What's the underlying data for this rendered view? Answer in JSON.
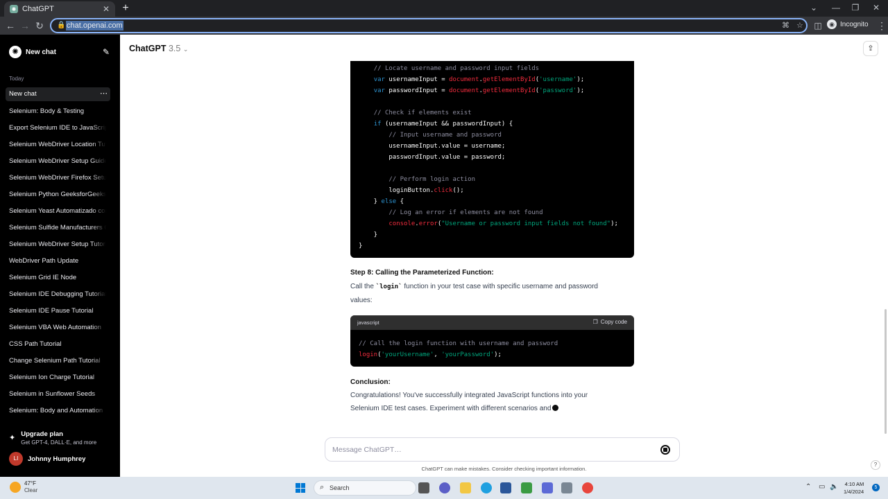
{
  "browser": {
    "tab_title": "ChatGPT",
    "tab_close": "✕",
    "new_tab": "+",
    "url": "chat.openai.com",
    "incognito_label": "Incognito",
    "window_controls": [
      "⌄",
      "—",
      "❐",
      "✕"
    ]
  },
  "sidebar": {
    "new_chat": "New chat",
    "section_today": "Today",
    "active_chat": "New chat",
    "items": [
      "Selenium: Body & Testing",
      "Export Selenium IDE to JavaScript",
      "Selenium WebDriver Location Tutorial",
      "Selenium WebDriver Setup Guide",
      "Selenium WebDriver Firefox Setup",
      "Selenium Python GeeksforGeeks",
      "Selenium Yeast Automatizado com",
      "Selenium Sulfide Manufacturers G",
      "Selenium WebDriver Setup Tutorial",
      "WebDriver Path Update",
      "Selenium Grid IE Node",
      "Selenium IDE Debugging Tutorial",
      "Selenium IDE Pause Tutorial",
      "Selenium VBA Web Automation",
      "CSS Path Tutorial",
      "Change Selenium Path Tutorial",
      "Selenium Ion Charge Tutorial",
      "Selenium in Sunflower Seeds",
      "Selenium: Body and Automation"
    ],
    "upgrade_title": "Upgrade plan",
    "upgrade_sub": "Get GPT-4, DALL·E, and more",
    "user_initials": "LI",
    "user_name": "Johnny Humphrey"
  },
  "main": {
    "model_name": "ChatGPT",
    "model_version": "3.5",
    "step_title": "Step 8: Calling the Parameterized Function:",
    "step_text_pre": "Call the ",
    "step_text_code": "`login`",
    "step_text_post": " function in your test case with specific username and password values:",
    "code2_lang": "javascript",
    "copy_label": "Copy code",
    "conclusion_title": "Conclusion:",
    "conclusion_text": "Congratulations! You've successfully integrated JavaScript functions into your Selenium IDE test cases. Experiment with different scenarios and",
    "composer_placeholder": "Message ChatGPT…",
    "disclaimer": "ChatGPT can make mistakes. Consider checking important information.",
    "help": "?"
  },
  "code1_lines": [
    "    // Locate username and password input fields",
    "    var usernameInput = document.getElementById('username');",
    "    var passwordInput = document.getElementById('password');",
    "",
    "    // Check if elements exist",
    "    if (usernameInput && passwordInput) {",
    "        // Input username and password",
    "        usernameInput.value = username;",
    "        passwordInput.value = password;",
    "",
    "        // Perform login action",
    "        loginButton.click();",
    "    } else {",
    "        // Log an error if elements are not found",
    "        console.error(\"Username or password input fields not found\");",
    "    }",
    "}"
  ],
  "code2_lines": [
    "// Call the login function with username and password",
    "login('yourUsername', 'yourPassword');"
  ],
  "taskbar": {
    "temp": "47°F",
    "condition": "Clear",
    "search": "Search",
    "time": "4:10 AM",
    "date": "1/4/2024",
    "notifications": "5"
  }
}
